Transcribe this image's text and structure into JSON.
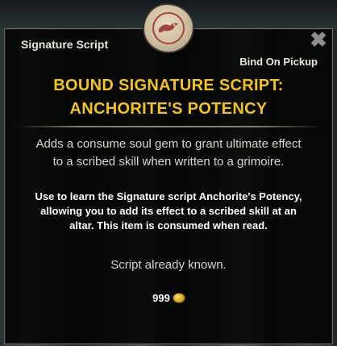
{
  "tooltip": {
    "header_title": "Signature Script",
    "bind_type": "Bind On Pickup",
    "item_name_line1": "BOUND SIGNATURE SCRIPT:",
    "item_name_line2": "ANCHORITE'S POTENCY",
    "description_line1": "Adds a consume soul gem to grant ultimate effect",
    "description_line2": "to a scribed skill when written to a grimoire.",
    "use_line1": "Use to learn the Signature script Anchorite's Potency,",
    "use_line2": "allowing you to add its effect to a scribed skill at an",
    "use_line3": "altar. This item is consumed when read.",
    "status": "Script already known.",
    "value": "999",
    "close_glyph": "✖",
    "icons": {
      "item": "scroll-seal-icon",
      "currency": "gold-coin-icon",
      "close": "close-icon"
    },
    "colors": {
      "item_name": "#f2c21f",
      "seal_red": "#a4453b"
    }
  }
}
